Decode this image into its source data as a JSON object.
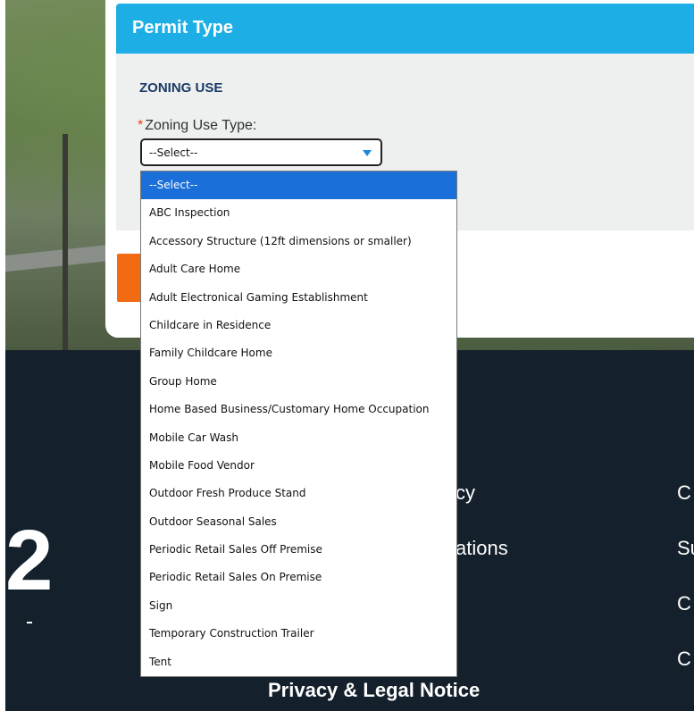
{
  "card": {
    "title": "Permit Type",
    "section_title": "ZONING USE",
    "required_marker": "*",
    "field_label": "Zoning Use Type:"
  },
  "select": {
    "value": "--Select--",
    "options": [
      "--Select--",
      "ABC Inspection",
      "Accessory Structure (12ft dimensions or smaller)",
      "Adult Care Home",
      "Adult Electronical Gaming Establishment",
      "Childcare in Residence",
      "Family Childcare Home",
      "Group Home",
      "Home Based Business/Customary Home Occupation",
      "Mobile Car Wash",
      "Mobile Food Vendor",
      "Outdoor Fresh Produce Stand",
      "Outdoor Seasonal Sales",
      "Periodic Retail Sales Off Premise",
      "Periodic Retail Sales On Premise",
      "Sign",
      "Temporary Construction Trailer",
      "Tent"
    ],
    "selected_index": 0,
    "accent_color": "#1a6fd9"
  },
  "colors": {
    "header": "#1eaee6",
    "footer": "#14202b",
    "orange_button": "#f26a11"
  },
  "footer": {
    "link_1": "cy",
    "link_2": "ations",
    "right_1": "C",
    "right_2": "Su",
    "right_3": "C",
    "right_4": "C",
    "bottom_text": "Privacy & Legal Notice",
    "logo_glyph": "2"
  }
}
